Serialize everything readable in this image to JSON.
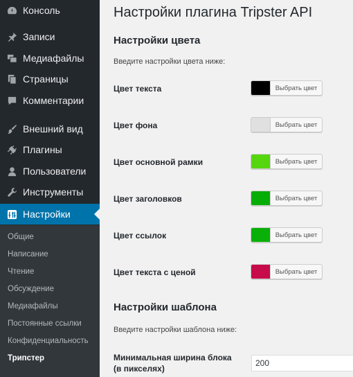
{
  "sidebar": {
    "items": [
      {
        "label": "Консоль",
        "icon": "dashboard-icon"
      },
      {
        "label": "Записи",
        "icon": "pin-icon"
      },
      {
        "label": "Медиафайлы",
        "icon": "media-icon"
      },
      {
        "label": "Страницы",
        "icon": "pages-icon"
      },
      {
        "label": "Комментарии",
        "icon": "comments-icon"
      },
      {
        "label": "Внешний вид",
        "icon": "appearance-icon"
      },
      {
        "label": "Плагины",
        "icon": "plugins-icon"
      },
      {
        "label": "Пользователи",
        "icon": "users-icon"
      },
      {
        "label": "Инструменты",
        "icon": "tools-icon"
      },
      {
        "label": "Настройки",
        "icon": "settings-icon",
        "active": true
      }
    ],
    "submenu": [
      {
        "label": "Общие"
      },
      {
        "label": "Написание"
      },
      {
        "label": "Чтение"
      },
      {
        "label": "Обсуждение"
      },
      {
        "label": "Медиафайлы"
      },
      {
        "label": "Постоянные ссылки"
      },
      {
        "label": "Конфиденциальность"
      },
      {
        "label": "Трипстер",
        "current": true
      }
    ]
  },
  "main": {
    "title": "Настройки плагина Tripster API",
    "color_section": {
      "title": "Настройки цвета",
      "description": "Введите настройки цвета ниже:",
      "fields": [
        {
          "label": "Цвет текста",
          "button": "Выбрать цвет",
          "color": "#000000"
        },
        {
          "label": "Цвет фона",
          "button": "Выбрать цвет",
          "color": "#e0e0e0"
        },
        {
          "label": "Цвет основной рамки",
          "button": "Выбрать цвет",
          "color": "#55d60f"
        },
        {
          "label": "Цвет заголовков",
          "button": "Выбрать цвет",
          "color": "#07ad07"
        },
        {
          "label": "Цвет ссылок",
          "button": "Выбрать цвет",
          "color": "#08b008"
        },
        {
          "label": "Цвет текста с ценой",
          "button": "Выбрать цвет",
          "color": "#c70a4a"
        }
      ]
    },
    "template_section": {
      "title": "Настройки шаблона",
      "description": "Введите настройки шаблона ниже:",
      "min_width_label_line1": "Минимальная ширина блока",
      "min_width_label_line2": "(в пикселях)",
      "min_width_value": "200"
    }
  },
  "colors": {
    "sidebar_bg": "#23282d",
    "submenu_bg": "#32373c",
    "active_bg": "#0073aa",
    "content_bg": "#f1f1f1"
  }
}
